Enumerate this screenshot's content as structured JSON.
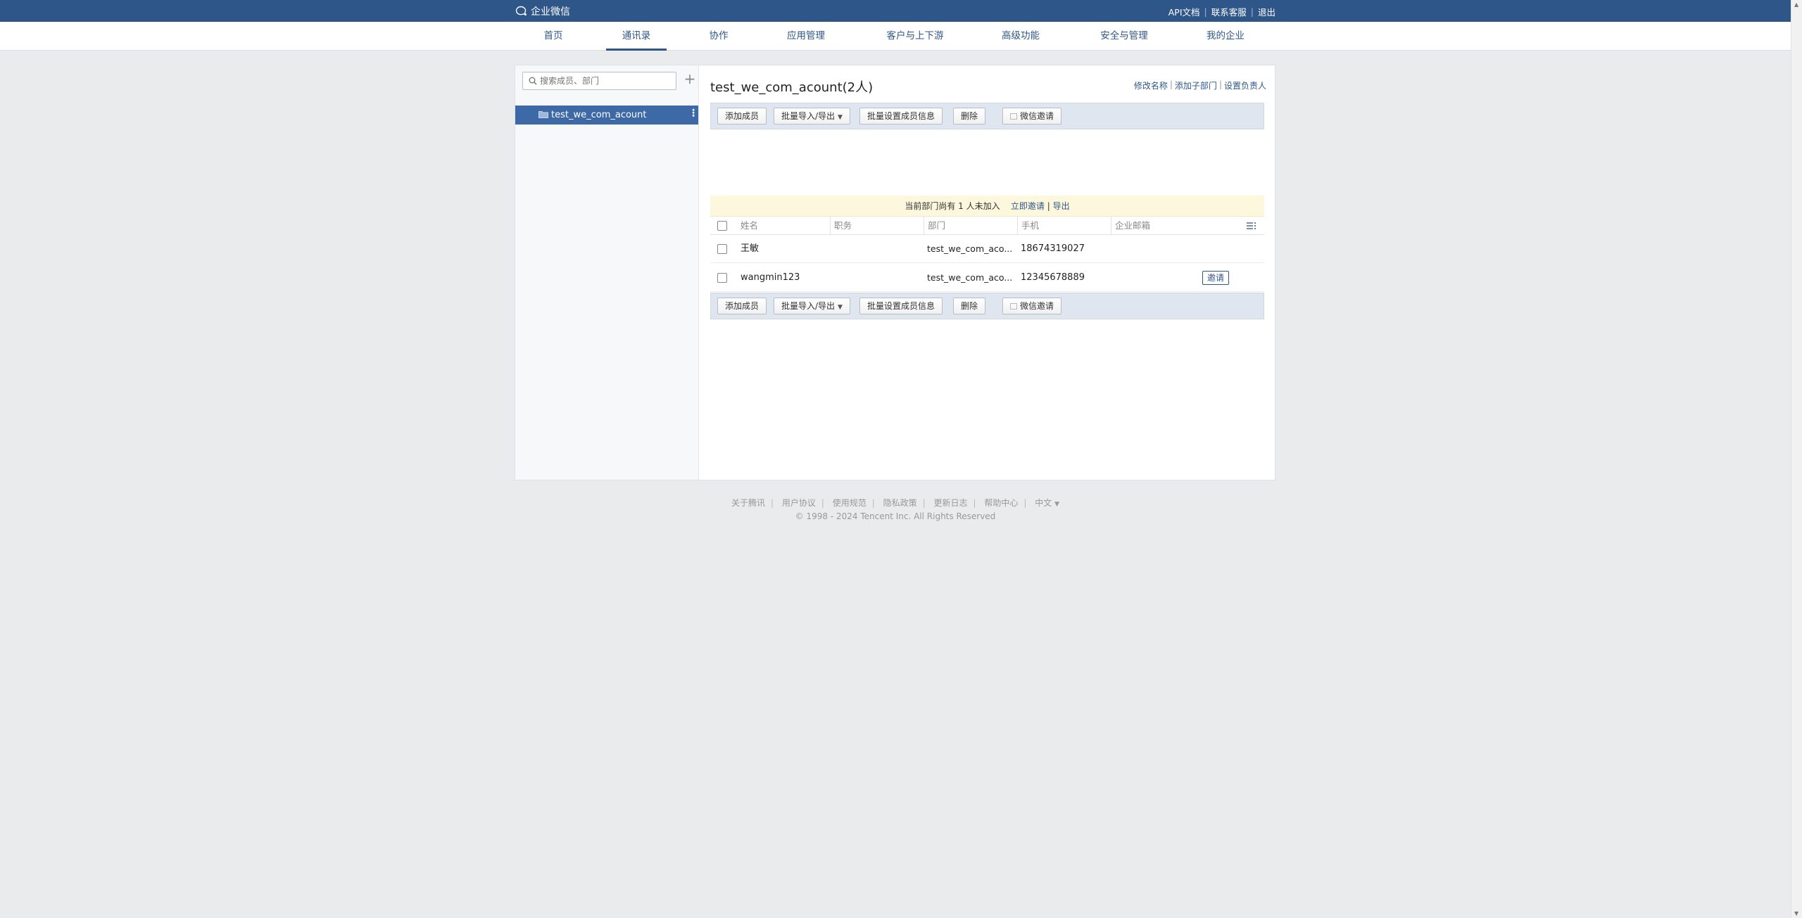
{
  "header": {
    "logo_text": "企业微信",
    "links": [
      "API文档",
      "联系客服",
      "退出"
    ]
  },
  "nav": {
    "items": [
      "首页",
      "通讯录",
      "协作",
      "应用管理",
      "客户与上下游",
      "高级功能",
      "安全与管理",
      "我的企业"
    ],
    "active": "通讯录"
  },
  "sidebar": {
    "search_placeholder": "搜索成员、部门",
    "add_icon": "+",
    "tree": [
      {
        "label": "test_we_com_acount",
        "selected": true
      }
    ]
  },
  "department": {
    "title": "test_we_com_acount(2人)",
    "actions": [
      "修改名称",
      "添加子部门",
      "设置负责人"
    ]
  },
  "toolbar": {
    "add_member": "添加成员",
    "import_export": "批量导入/导出",
    "batch_set": "批量设置成员信息",
    "delete": "删除",
    "wechat_invite": "微信邀请"
  },
  "notice": {
    "text": "当前部门尚有 1 人未加入",
    "invite_now": "立即邀请",
    "export": "导出"
  },
  "table": {
    "columns": [
      "姓名",
      "职务",
      "部门",
      "手机",
      "企业邮箱"
    ],
    "rows": [
      {
        "name": "王敏",
        "title": "",
        "dept": "test_we_com_aco...",
        "phone": "18674319027",
        "email": "",
        "action": ""
      },
      {
        "name": "wangmin123",
        "title": "",
        "dept": "test_we_com_aco...",
        "phone": "12345678889",
        "email": "",
        "action": "邀请"
      }
    ]
  },
  "footer": {
    "links": [
      "关于腾讯",
      "用户协议",
      "使用规范",
      "隐私政策",
      "更新日志",
      "帮助中心"
    ],
    "language": "中文",
    "copyright": "© 1998 - 2024 Tencent Inc. All Rights Reserved"
  },
  "colors": {
    "brand": "#2f5688",
    "selected": "#3d6aa6",
    "toolbar_bg": "#dfe6ef",
    "notice_bg": "#fdf8dd"
  }
}
